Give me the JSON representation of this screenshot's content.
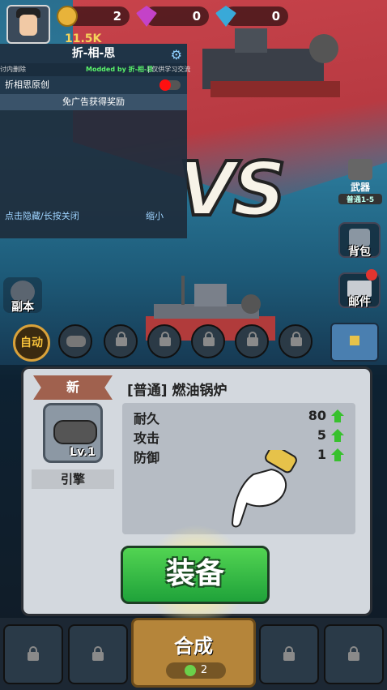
{
  "resources": {
    "gold": "2",
    "gems_pink": "0",
    "gems_blue": "0",
    "power": "11.5K"
  },
  "mod_menu": {
    "title": "折-相-思",
    "sub_left": "讨内删除",
    "sub_mid": "Modded by 折-相-思",
    "sub_right": "| 仅供学习交流",
    "toggle_label": "折相思原创",
    "toggle_on": true,
    "ad_button": "免广告获得奖励",
    "footer_left": "点击隐藏/长按关闭",
    "footer_right": "缩小"
  },
  "side_buttons": {
    "weapon": "武器",
    "weapon_sub": "普通1-5",
    "backpack": "背包",
    "copy": "副本",
    "mail": "邮件",
    "auto": "自动开"
  },
  "dialog": {
    "new_tag": "新",
    "item_name": "[普通] 燃油锅炉",
    "level": "Lv.1",
    "item_type": "引擎",
    "stats": [
      {
        "name": "耐久",
        "value": "80"
      },
      {
        "name": "攻击",
        "value": "5"
      },
      {
        "name": "防御",
        "value": "1"
      }
    ],
    "equip_button": "装备"
  },
  "bottom": {
    "merge_label": "合成",
    "merge_cost": "2"
  },
  "colors": {
    "equip_green": "#2fbf3f",
    "toggle_red": "#ff1010",
    "new_tag": "#a0614e",
    "up_arrow": "#38c12e"
  }
}
